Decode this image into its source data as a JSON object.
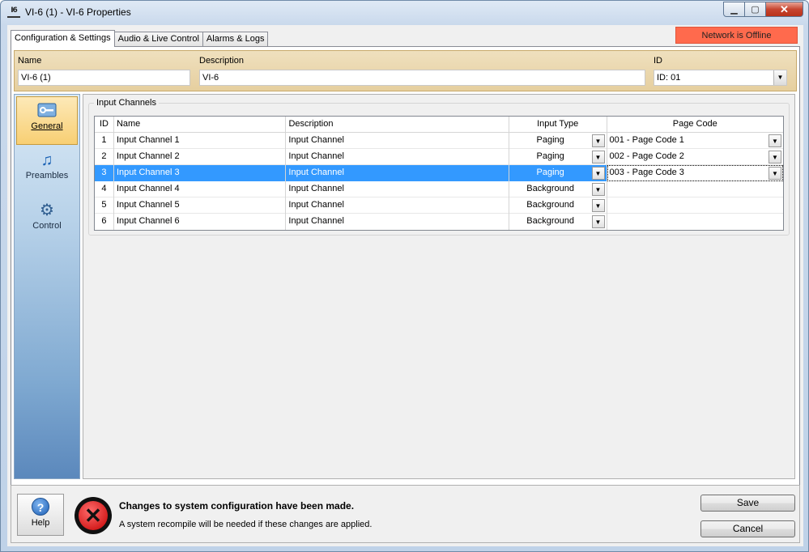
{
  "window": {
    "app_icon_text": "I6",
    "title": "VI-6 (1) - VI-6 Properties",
    "min_icon": "minimize-icon",
    "max_icon": "maximize-icon",
    "close_icon": "close-icon"
  },
  "tabs": [
    {
      "label": "Configuration & Settings",
      "active": true
    },
    {
      "label": "Audio & Live Control",
      "active": false
    },
    {
      "label": "Alarms & Logs",
      "active": false
    }
  ],
  "status": {
    "network": "Network is Offline",
    "color": "#ff6a4d"
  },
  "header": {
    "name_label": "Name",
    "name_value": "VI-6 (1)",
    "description_label": "Description",
    "description_value": "VI-6",
    "id_label": "ID",
    "id_value": "ID: 01"
  },
  "nav": [
    {
      "label": "General",
      "icon": "wrench-icon",
      "active": true
    },
    {
      "label": "Preambles",
      "icon": "music-note-icon",
      "active": false
    },
    {
      "label": "Control",
      "icon": "gear-icon",
      "active": false
    }
  ],
  "group": {
    "title": "Input Channels"
  },
  "grid": {
    "columns": [
      "ID",
      "Name",
      "Description",
      "Input Type",
      "Page Code"
    ],
    "rows": [
      {
        "id": "1",
        "name": "Input Channel 1",
        "description": "Input Channel",
        "type": "Paging",
        "page_code": "001 - Page Code 1"
      },
      {
        "id": "2",
        "name": "Input Channel 2",
        "description": "Input Channel",
        "type": "Paging",
        "page_code": "002 - Page Code 2"
      },
      {
        "id": "3",
        "name": "Input Channel 3",
        "description": "Input Channel",
        "type": "Paging",
        "page_code": "003 - Page Code 3"
      },
      {
        "id": "4",
        "name": "Input Channel 4",
        "description": "Input Channel",
        "type": "Background",
        "page_code": ""
      },
      {
        "id": "5",
        "name": "Input Channel 5",
        "description": "Input Channel",
        "type": "Background",
        "page_code": ""
      },
      {
        "id": "6",
        "name": "Input Channel 6",
        "description": "Input Channel",
        "type": "Background",
        "page_code": ""
      }
    ],
    "selected_row": 3,
    "selection_color": "#3399ff"
  },
  "footer": {
    "help_label": "Help",
    "message_title": "Changes to system configuration have been made.",
    "message_detail": "A system recompile will be needed if these changes are applied.",
    "save_label": "Save",
    "cancel_label": "Cancel"
  }
}
